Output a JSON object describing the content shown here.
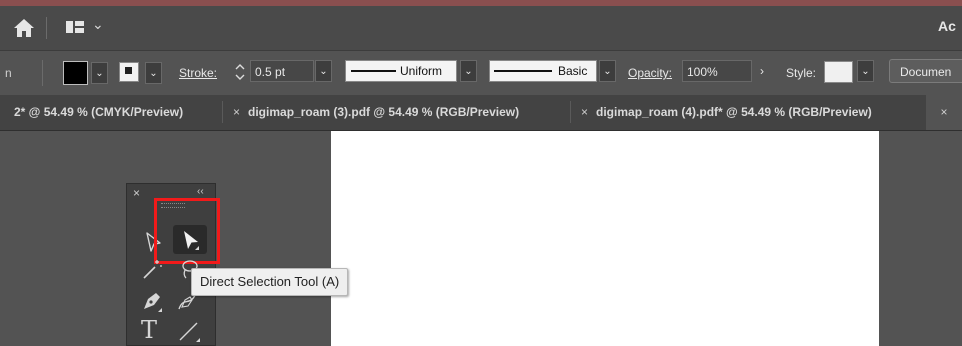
{
  "topbar": {
    "app_label": "Ac",
    "workspace_chevron": "⌄"
  },
  "controlbar": {
    "left_label": "n",
    "fill_chevron": "⌄",
    "stroke_swatch_chevron": "⌄",
    "stroke_label": "Stroke:",
    "stroke_weight": "0.5 pt",
    "stroke_weight_chevron": "⌄",
    "variable_width_profile": "Uniform",
    "profile_chevron": "⌄",
    "brush_definition": "Basic",
    "brush_chevron": "⌄",
    "opacity_label": "Opacity:",
    "opacity_value": "100%",
    "opacity_arrow": "›",
    "style_label": "Style:",
    "style_chevron": "⌄",
    "document_button": "Documen"
  },
  "tabs": [
    {
      "label": "2* @ 54.49 % (CMYK/Preview)",
      "close": ""
    },
    {
      "label": "digimap_roam (3).pdf @ 54.49 % (RGB/Preview)",
      "close": "×"
    },
    {
      "label": "digimap_roam (4).pdf* @ 54.49 % (RGB/Preview)",
      "close": "×"
    },
    {
      "label": "",
      "close": "×"
    }
  ],
  "tool_panel": {
    "close": "×",
    "collapse": "‹‹",
    "type_tool_glyph": "T"
  },
  "tooltip": {
    "text": "Direct Selection Tool (A)"
  },
  "colors": {
    "highlight": "#f21a1a",
    "artboard": "#ffffff",
    "canvas": "#535353"
  }
}
